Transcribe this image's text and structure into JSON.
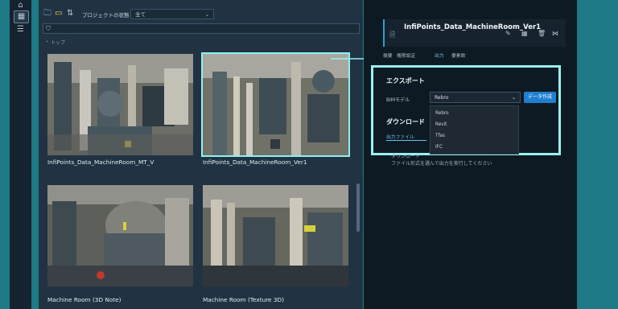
{
  "toolbar": {
    "status_label": "プロジェクトの状態",
    "status_value": "全て",
    "filter_placeholder": ""
  },
  "breadcrumb": "トップ",
  "thumbnails": [
    {
      "caption": "InfiPoints_Data_MachineRoom_MT_V"
    },
    {
      "caption": "InfiPoints_Data_MachineRoom_Ver1"
    },
    {
      "caption": "Machine Room (3D Note)"
    },
    {
      "caption": "Machine Room (Texture 3D)"
    }
  ],
  "panel": {
    "title": "InfiPoints_Data_MachineRoom_Ver1",
    "tabs": [
      "概要",
      "権限設定",
      "出力",
      "要素数"
    ],
    "export": {
      "heading": "エクスポート",
      "bim_label": "BIMモデル",
      "bim_selected": "Rebro",
      "create_button": "データ作成",
      "options": [
        "Rebro",
        "Revit",
        "Tfas",
        "IFC"
      ]
    },
    "download": {
      "heading": "ダウンロード",
      "tab": "出力ファイル",
      "text": "ダウンロード",
      "hint": "ファイル形式を選んで出力を実行してください"
    }
  },
  "colors": {
    "accent": "#8df0f0",
    "panel_bg": "#0e1a23",
    "button": "#1f7fd0"
  }
}
